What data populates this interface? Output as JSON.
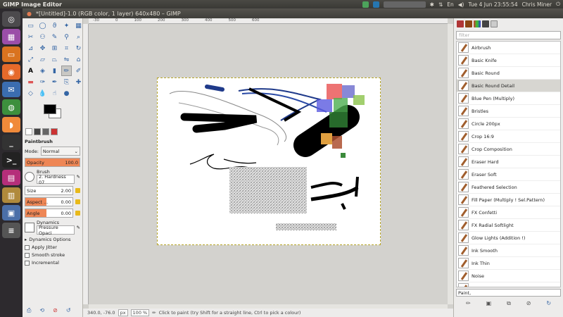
{
  "topbar": {
    "app_title": "GIMP Image Editor",
    "date_time": "Tue  4 Jun  23:55:54",
    "user": "Chris Miner"
  },
  "launcher": {
    "items": [
      "dash-home",
      "gimp",
      "files",
      "firefox",
      "thunderbird",
      "chrome",
      "app-orange",
      "terminal",
      "terminal-2",
      "libreoffice",
      "files-2",
      "network",
      "dock-more"
    ]
  },
  "window": {
    "title": "*[Untitled]-1.0 (RGB color, 1 layer) 640x480 – GIMP"
  },
  "toolbox": {
    "tool_name": "Paintbrush",
    "mode_label": "Mode:",
    "mode_value": "Normal",
    "opacity_label": "Opacity",
    "opacity_value": "100.0",
    "opacity_fraction": 1.0,
    "brush_label": "Brush",
    "brush_value": "2. Hardness 07",
    "size_label": "Size",
    "size_value": "2.00",
    "aspect_label": "Aspect ...",
    "aspect_value": "0.00",
    "angle_label": "Angle",
    "angle_value": "0.00",
    "dynamics_label": "Dynamics",
    "dynamics_value": "Pressure Opaci",
    "dynamics_options": "Dynamics Options",
    "apply_jitter": "Apply Jitter",
    "smooth_stroke": "Smooth stroke",
    "incremental": "Incremental"
  },
  "canvas": {
    "ruler_ticks": [
      "0",
      "100",
      "200",
      "300",
      "400",
      "500",
      "600"
    ],
    "ruler_lead": "-30"
  },
  "statusbar": {
    "coords": "340.0, -76.0",
    "unit": "px",
    "zoom": "100 %",
    "hint": "Click to paint (try Shift for a straight line, Ctrl to pick a colour)"
  },
  "brushes": {
    "filter_placeholder": "filter",
    "items": [
      "Airbrush",
      "Basic Knife",
      "Basic Round",
      "Basic Round Detail",
      "Blue Pen (Multiply)",
      "Bristles",
      "Circle 200px",
      "Crop 16:9",
      "Crop Composition",
      "Eraser Hard",
      "Eraser Soft",
      "Feathered Selection",
      "Fill Paper (Multiply ! Sel.Pattern)",
      "FX Confetti",
      "FX Radial Softlight",
      "Glow Lights (Addition !)",
      "Ink Smooth",
      "Ink Thin",
      "Noise",
      "Pencil"
    ],
    "selected_index": 3,
    "tag_value": "Paint,"
  },
  "colors": {
    "accent": "#ee8655",
    "selection_border": "#b6a52b",
    "ubuntu_orange": "#dd4814"
  }
}
